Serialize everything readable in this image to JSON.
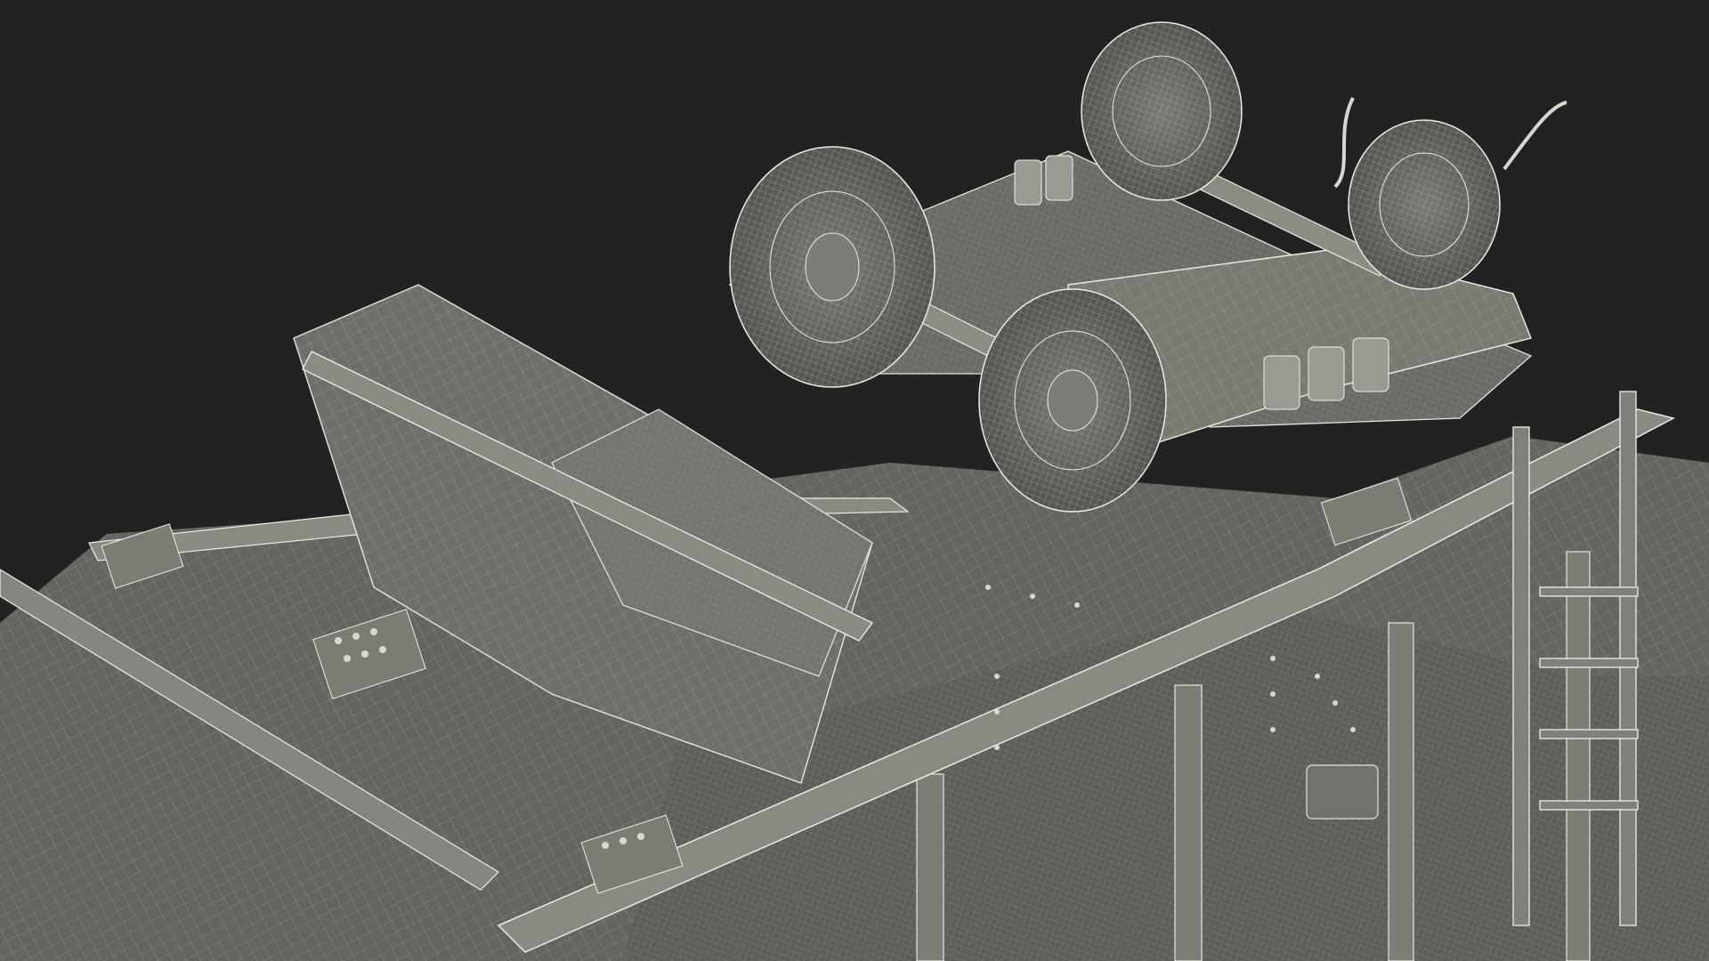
{
  "scene": {
    "background": "#222222",
    "model": "3d-wireframe-render",
    "subject": "hopper-railcar-with-bogie",
    "shaded_color": "#6b6b66",
    "wire_color": "#e6e6dd"
  }
}
